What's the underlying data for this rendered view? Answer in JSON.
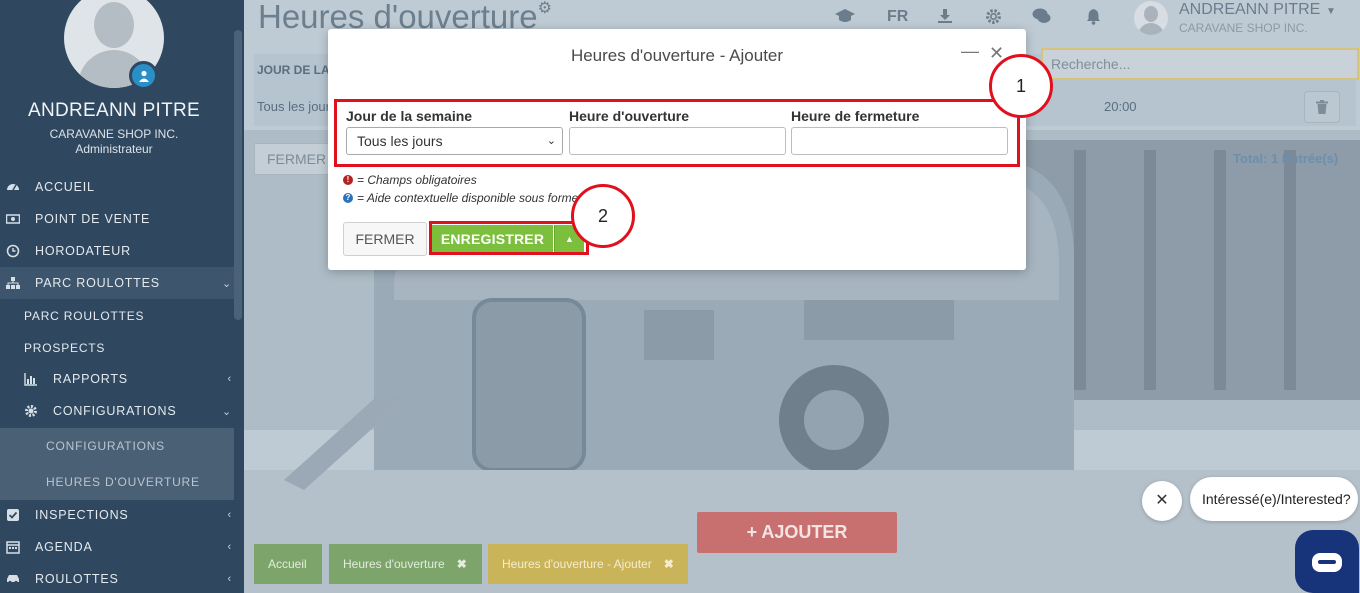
{
  "sidebar": {
    "user_name": "ANDREANN PITRE",
    "user_company": "CARAVANE SHOP INC.",
    "user_role": "Administrateur",
    "items": [
      {
        "label": "ACCUEIL",
        "icon": "dashboard-icon"
      },
      {
        "label": "POINT DE VENTE",
        "icon": "cash-icon"
      },
      {
        "label": "HORODATEUR",
        "icon": "clock-icon"
      },
      {
        "label": "PARC ROULOTTES",
        "icon": "sitemap-icon"
      }
    ],
    "sub_items": [
      "PARC ROULOTTES",
      "PROSPECTS",
      "RAPPORTS",
      "CONFIGURATIONS"
    ],
    "sub_sub_items": [
      "CONFIGURATIONS",
      "HEURES D'OUVERTURE"
    ],
    "bottom_items": [
      {
        "label": "INSPECTIONS",
        "icon": "checkbox-icon"
      },
      {
        "label": "AGENDA",
        "icon": "calendar-icon"
      },
      {
        "label": "ROULOTTES",
        "icon": "car-icon"
      }
    ]
  },
  "header": {
    "page_title": "Heures d'ouverture",
    "lang": "FR",
    "user_name": "ANDREANN PITRE",
    "user_company": "CARAVANE SHOP INC."
  },
  "table": {
    "header_jour": "JOUR DE LA",
    "search_placeholder": "Recherche...",
    "row_day": "Tous les jour",
    "row_close": "20:00",
    "fermer": "FERMER",
    "total": "Total: 1 Entrée(s)"
  },
  "actions": {
    "ajouter": "+ AJOUTER"
  },
  "breadcrumbs": [
    "Accueil",
    "Heures d'ouverture",
    "Heures d'ouverture - Ajouter"
  ],
  "modal": {
    "title": "Heures d'ouverture - Ajouter",
    "label_day": "Jour de la semaine",
    "label_open": "Heure d'ouverture",
    "label_close": "Heure de fermeture",
    "day_value": "Tous les jours",
    "open_value": "",
    "close_value": "",
    "legend_required": "= Champs obligatoires",
    "legend_help": "= Aide contextuelle disponible sous forme de bulle",
    "btn_fermer": "FERMER",
    "btn_save": "ENREGISTRER"
  },
  "annotations": {
    "callout_1": "1",
    "callout_2": "2"
  },
  "chat": {
    "bubble": "Intéressé(e)/Interested?"
  },
  "colors": {
    "sidebar_bg": "#2f4860",
    "save_green": "#7cbf3d",
    "annotation_red": "#e0101e",
    "ajouter_red": "#c86f6f",
    "chat_blue": "#17337a"
  }
}
